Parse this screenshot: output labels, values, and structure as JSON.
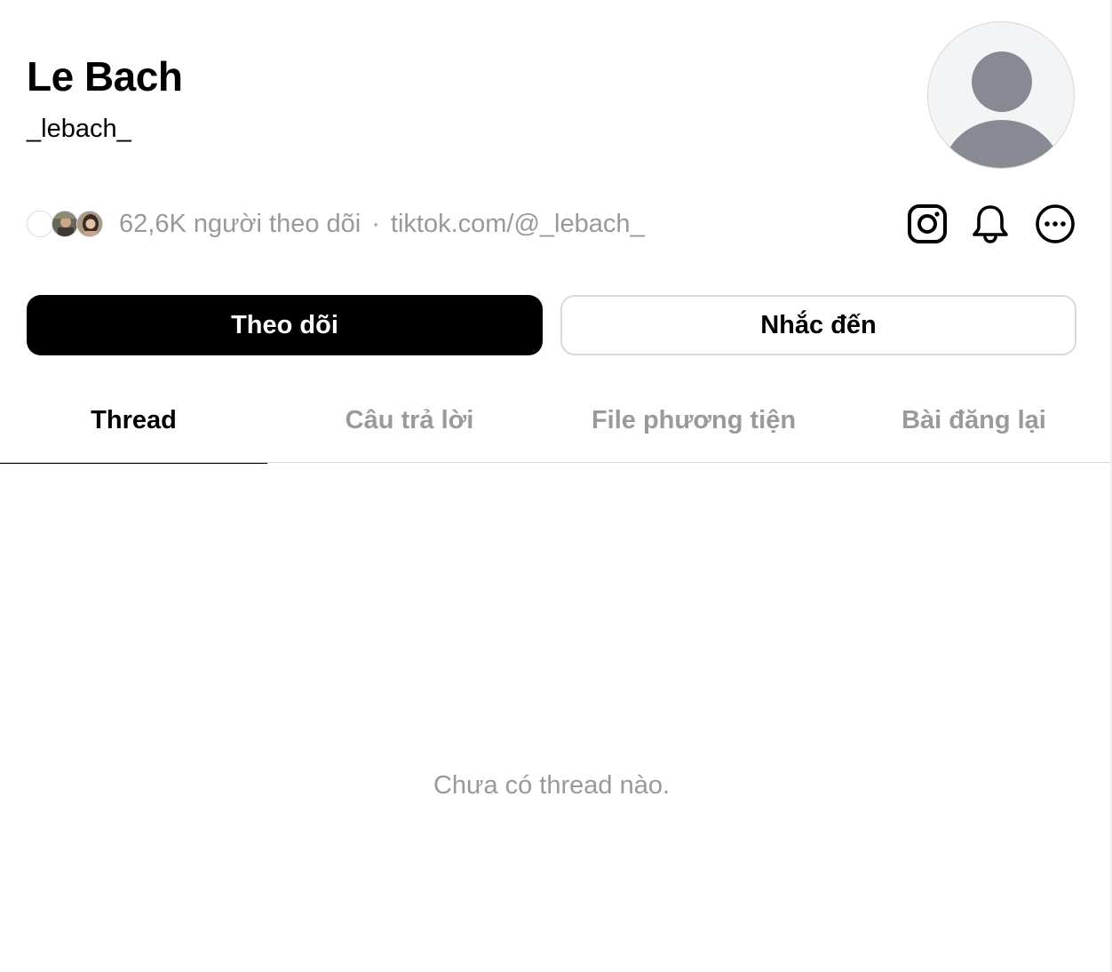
{
  "profile": {
    "name": "Le Bach",
    "handle": "_lebach_",
    "avatar_icon": "default-user-avatar"
  },
  "meta": {
    "followers_text": "62,6K người theo dõi",
    "separator": "·",
    "link_text": "tiktok.com/@_lebach_"
  },
  "actions": {
    "instagram_icon": "instagram-icon",
    "notification_icon": "bell-icon",
    "more_icon": "more-options-icon"
  },
  "buttons": {
    "follow_label": "Theo dõi",
    "mention_label": "Nhắc đến"
  },
  "tabs": [
    {
      "label": "Thread",
      "active": true
    },
    {
      "label": "Câu trả lời",
      "active": false
    },
    {
      "label": "File phương tiện",
      "active": false
    },
    {
      "label": "Bài đăng lại",
      "active": false
    }
  ],
  "feed": {
    "empty_message": "Chưa có thread nào."
  },
  "colors": {
    "primary": "#000000",
    "muted_text": "#999999",
    "border": "#d9d9d9",
    "avatar_placeholder": "#878a92"
  }
}
